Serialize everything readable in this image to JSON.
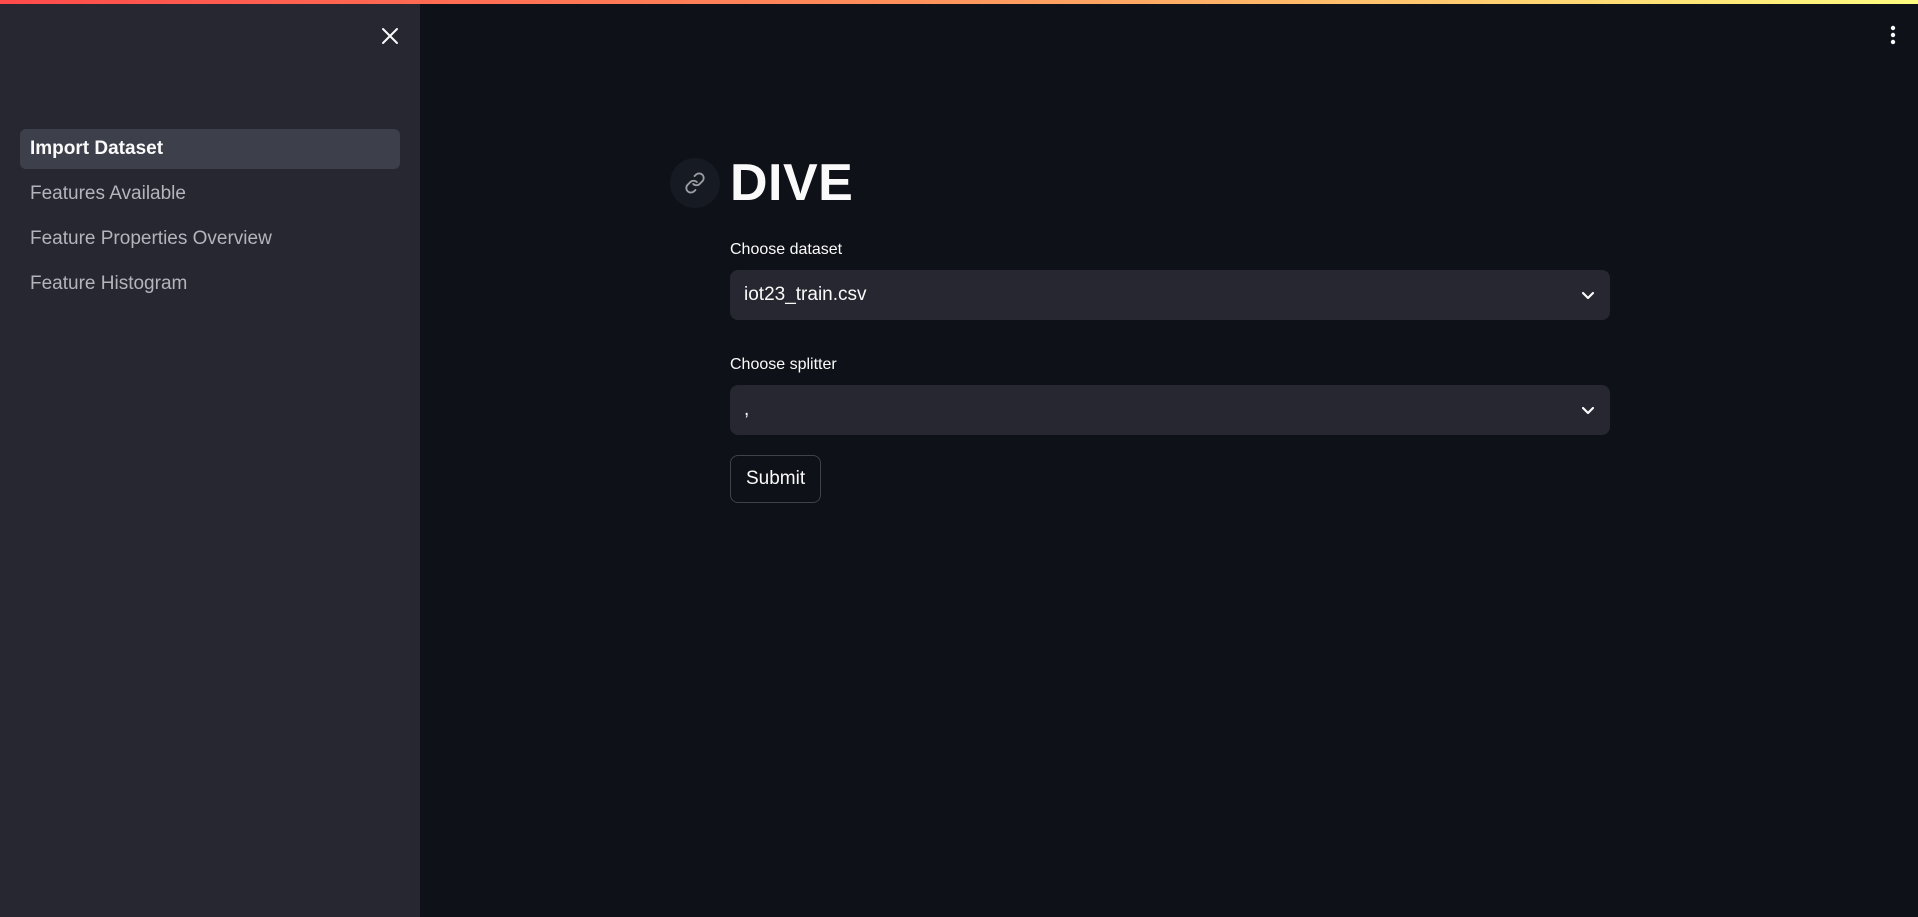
{
  "colors": {
    "sidebar_bg": "#262730",
    "main_bg": "#0e1117",
    "accent_gradient": [
      "#ff4b4b",
      "#fffd80"
    ]
  },
  "sidebar": {
    "close_icon": "close-icon",
    "items": [
      {
        "label": "Import Dataset",
        "active": true
      },
      {
        "label": "Features Available",
        "active": false
      },
      {
        "label": "Feature Properties Overview",
        "active": false
      },
      {
        "label": "Feature Histogram",
        "active": false
      }
    ]
  },
  "header": {
    "menu_icon": "kebab-menu-icon"
  },
  "main": {
    "title": "DIVE",
    "anchor_icon": "link-icon",
    "dataset": {
      "label": "Choose dataset",
      "value": "iot23_train.csv"
    },
    "splitter": {
      "label": "Choose splitter",
      "value": ","
    },
    "submit_label": "Submit"
  }
}
